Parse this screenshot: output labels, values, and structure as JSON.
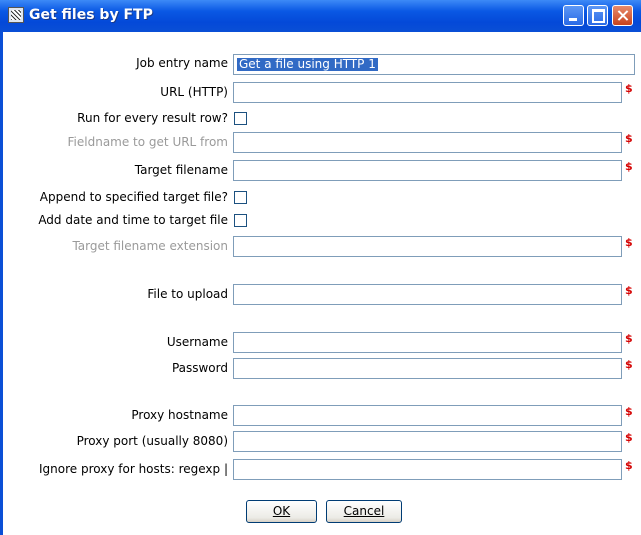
{
  "window": {
    "title": "Get files by FTP"
  },
  "form": {
    "job_entry_name": {
      "label": "Job entry name",
      "value": "Get a file using HTTP 1"
    },
    "url": {
      "label": "URL (HTTP)",
      "value": ""
    },
    "run_every_row": {
      "label": "Run for every result row?",
      "checked": false
    },
    "fieldname_url": {
      "label": "Fieldname to get URL from",
      "value": "",
      "disabled": true
    },
    "target_filename": {
      "label": "Target filename",
      "value": ""
    },
    "append_target": {
      "label": "Append to specified target file?",
      "checked": false
    },
    "add_date_time": {
      "label": "Add date and time to target file",
      "checked": false
    },
    "target_ext": {
      "label": "Target filename extension",
      "value": "",
      "disabled": true
    },
    "file_upload": {
      "label": "File to upload",
      "value": ""
    },
    "username": {
      "label": "Username",
      "value": ""
    },
    "password": {
      "label": "Password",
      "value": ""
    },
    "proxy_host": {
      "label": "Proxy hostname",
      "value": ""
    },
    "proxy_port": {
      "label": "Proxy port (usually 8080)",
      "value": ""
    },
    "ignore_proxy": {
      "label": "Ignore proxy for hosts: regexp |",
      "value": ""
    },
    "variable_marker": "$"
  },
  "buttons": {
    "ok": "OK",
    "cancel": "Cancel"
  }
}
